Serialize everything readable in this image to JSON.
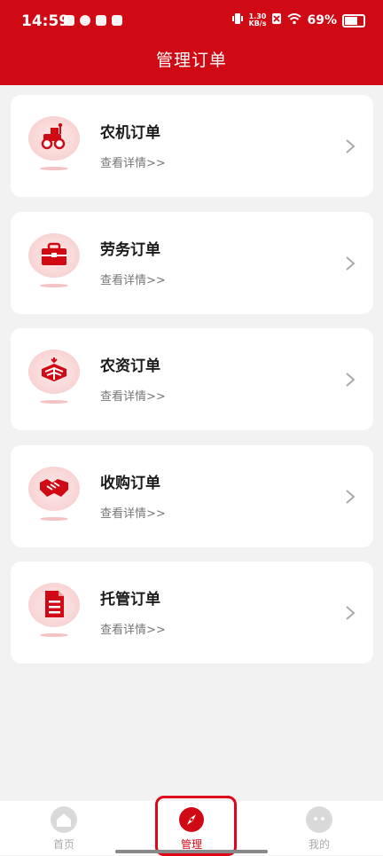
{
  "status_bar": {
    "time": "14:59",
    "speed": "1.30\nKB/s",
    "battery": "69%"
  },
  "header": {
    "title": "管理订单"
  },
  "cards": [
    {
      "title": "农机订单",
      "subtitle": "查看详情>>",
      "icon": "tractor-icon"
    },
    {
      "title": "劳务订单",
      "subtitle": "查看详情>>",
      "icon": "briefcase-icon"
    },
    {
      "title": "农资订单",
      "subtitle": "查看详情>>",
      "icon": "field-icon"
    },
    {
      "title": "收购订单",
      "subtitle": "查看详情>>",
      "icon": "handshake-icon"
    },
    {
      "title": "托管订单",
      "subtitle": "查看详情>>",
      "icon": "document-icon"
    }
  ],
  "tabbar": {
    "items": [
      {
        "label": "首页",
        "icon": "home-icon"
      },
      {
        "label": "管理",
        "icon": "compass-icon",
        "active": true
      },
      {
        "label": "我的",
        "icon": "profile-icon"
      }
    ]
  },
  "colors": {
    "brand": "#cf0a14",
    "active_tab": "#cf0a14"
  }
}
